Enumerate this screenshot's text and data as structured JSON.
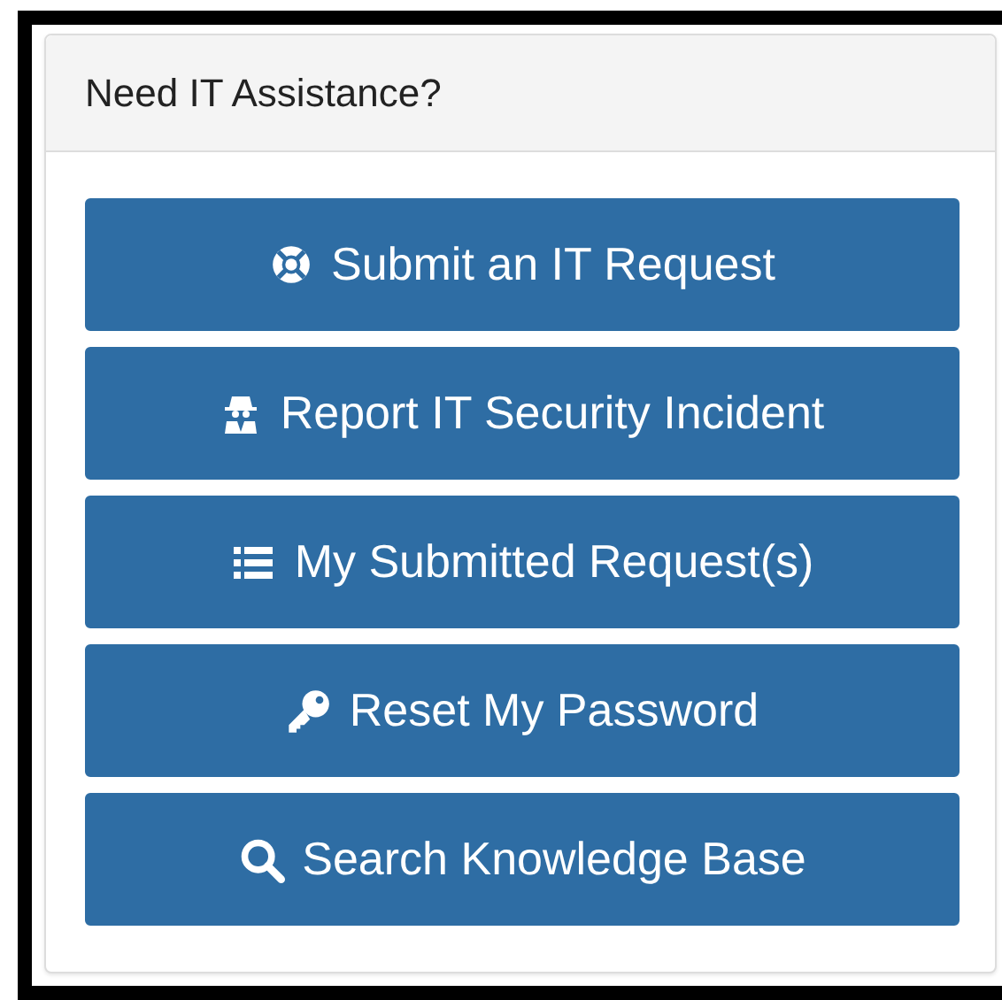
{
  "panel": {
    "title": "Need IT Assistance?"
  },
  "buttons": [
    {
      "label": "Submit an IT Request"
    },
    {
      "label": "Report IT Security Incident"
    },
    {
      "label": "My Submitted Request(s)"
    },
    {
      "label": "Reset My Password"
    },
    {
      "label": "Search Knowledge Base"
    }
  ]
}
